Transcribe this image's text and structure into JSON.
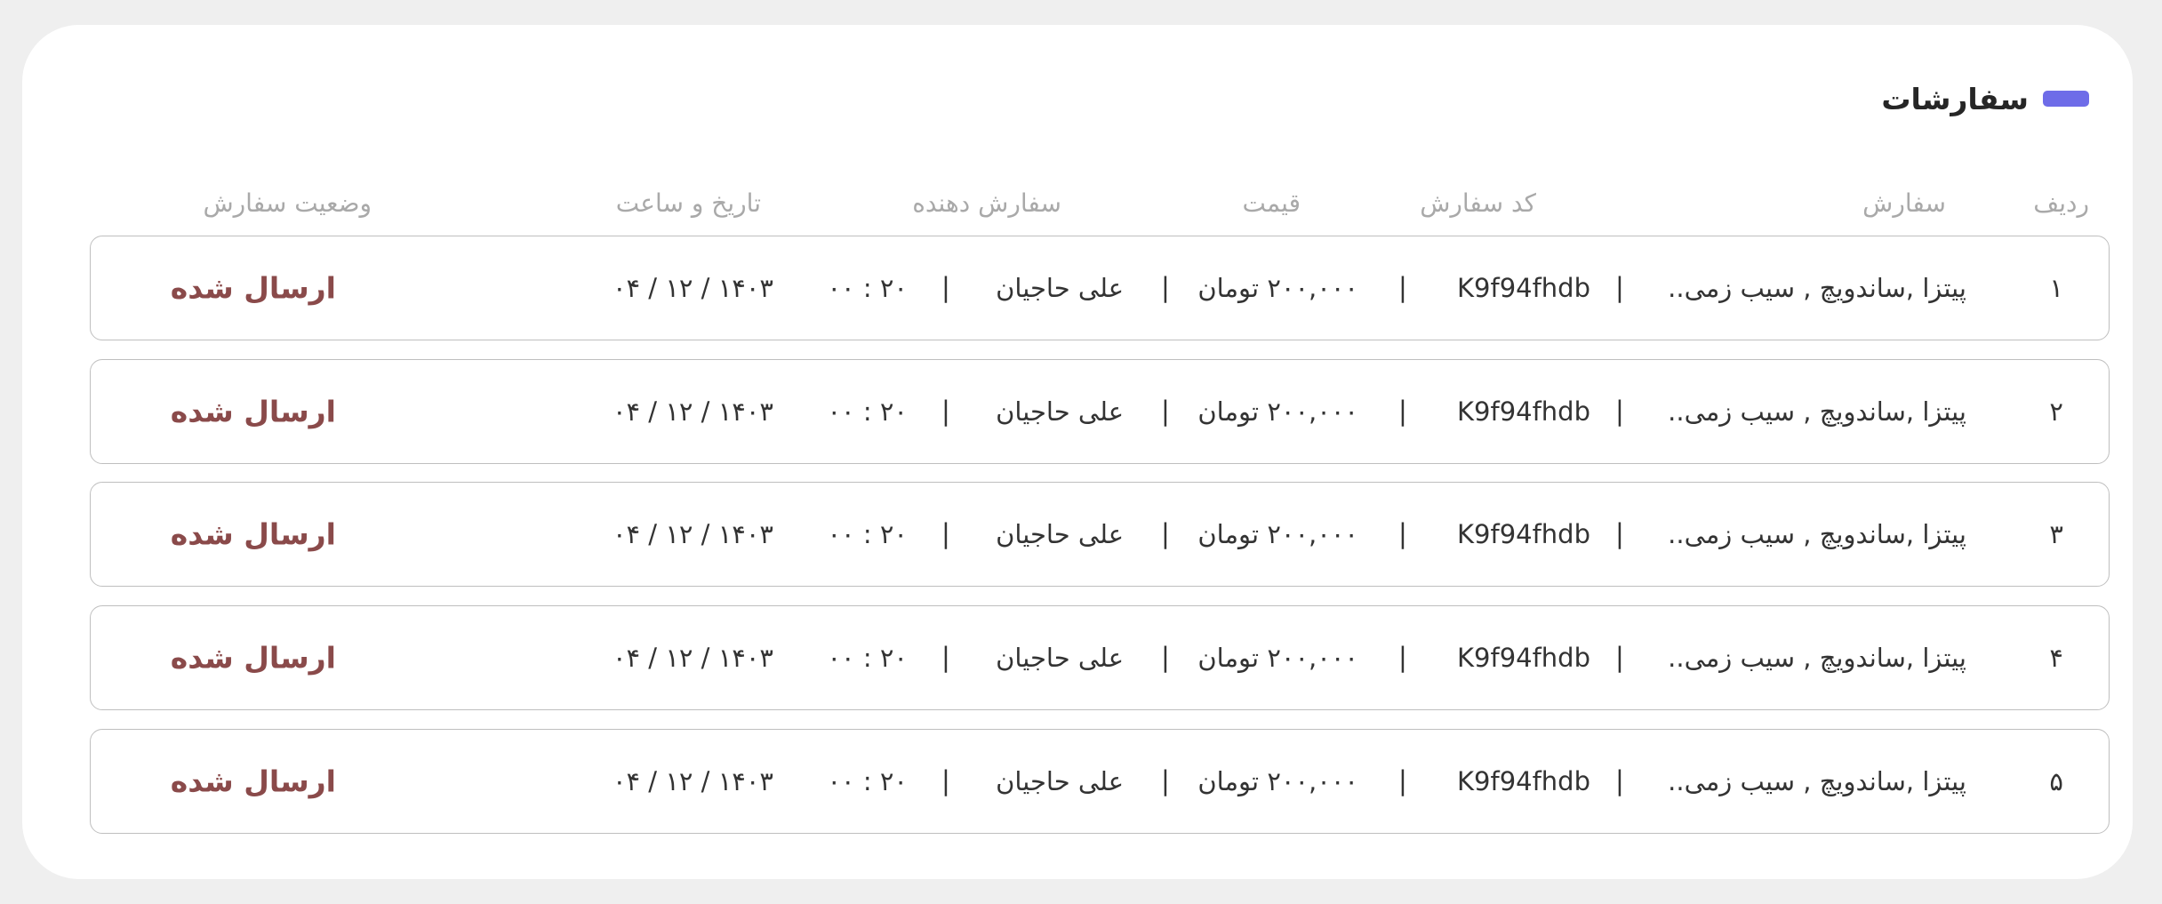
{
  "section": {
    "title": "سفارشات",
    "accent_color": "#6e6ce8"
  },
  "table": {
    "headers": {
      "row": "ردیف",
      "order": "سفارش",
      "code": "کد سفارش",
      "price": "قیمت",
      "customer": "سفارش دهنده",
      "datetime": "تاریخ و ساعت",
      "status": "وضعیت سفارش"
    },
    "separator": "|",
    "status_color": "#8a4a4a",
    "rows": [
      {
        "num": "۱",
        "order": "پیتزا ,ساندویچ , سیب زمی..",
        "code": "K9f94fhdb",
        "price": "۲۰۰,۰۰۰ تومان",
        "customer": "علی حاجیان",
        "date": "۱۴۰۳ / ۱۲ / ۰۴",
        "time": "۲۰ : ۰۰",
        "status": "ارسال شده"
      },
      {
        "num": "۲",
        "order": "پیتزا ,ساندویچ , سیب زمی..",
        "code": "K9f94fhdb",
        "price": "۲۰۰,۰۰۰ تومان",
        "customer": "علی حاجیان",
        "date": "۱۴۰۳ / ۱۲ / ۰۴",
        "time": "۲۰ : ۰۰",
        "status": "ارسال شده"
      },
      {
        "num": "۳",
        "order": "پیتزا ,ساندویچ , سیب زمی..",
        "code": "K9f94fhdb",
        "price": "۲۰۰,۰۰۰ تومان",
        "customer": "علی حاجیان",
        "date": "۱۴۰۳ / ۱۲ / ۰۴",
        "time": "۲۰ : ۰۰",
        "status": "ارسال شده"
      },
      {
        "num": "۴",
        "order": "پیتزا ,ساندویچ , سیب زمی..",
        "code": "K9f94fhdb",
        "price": "۲۰۰,۰۰۰ تومان",
        "customer": "علی حاجیان",
        "date": "۱۴۰۳ / ۱۲ / ۰۴",
        "time": "۲۰ : ۰۰",
        "status": "ارسال شده"
      },
      {
        "num": "۵",
        "order": "پیتزا ,ساندویچ , سیب زمی..",
        "code": "K9f94fhdb",
        "price": "۲۰۰,۰۰۰ تومان",
        "customer": "علی حاجیان",
        "date": "۱۴۰۳ / ۱۲ / ۰۴",
        "time": "۲۰ : ۰۰",
        "status": "ارسال شده"
      }
    ]
  }
}
